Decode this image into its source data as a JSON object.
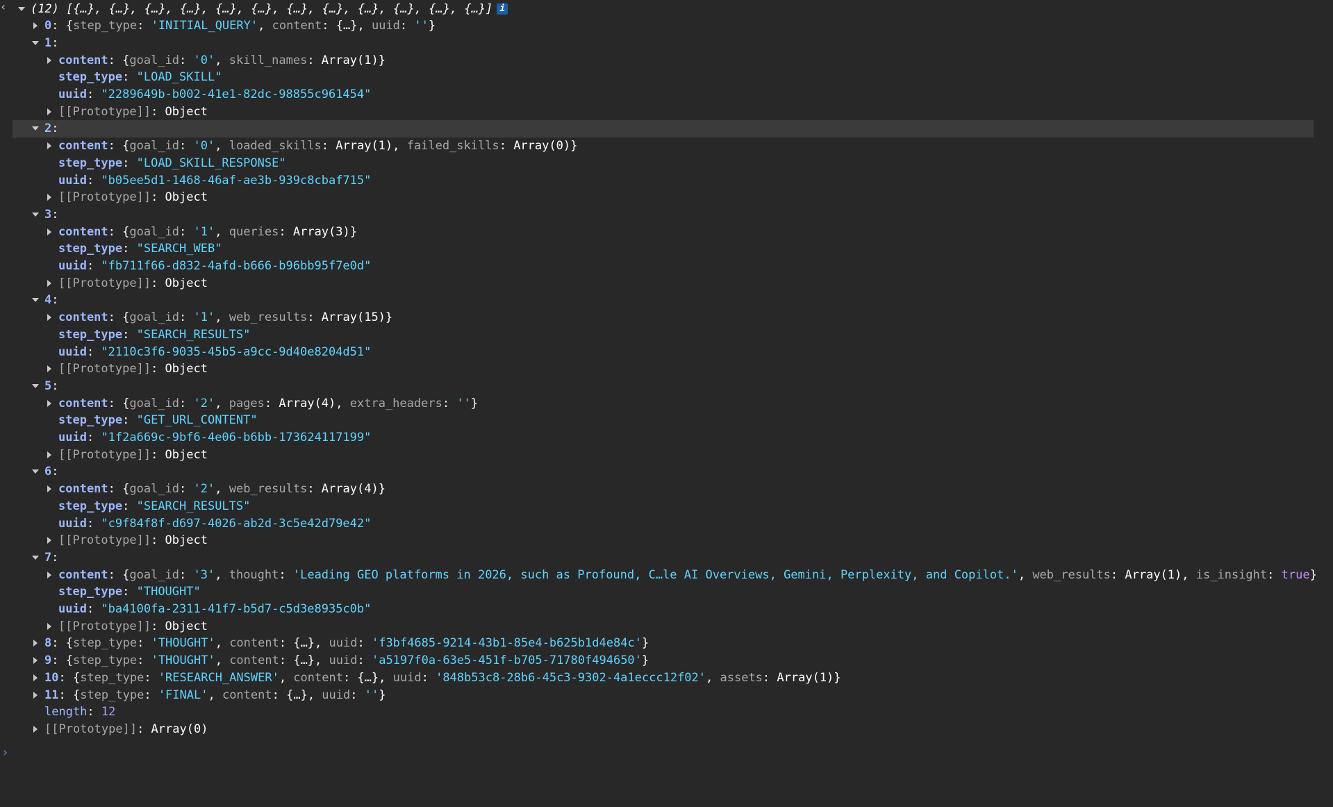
{
  "summary": {
    "count": "(12)",
    "preview": "[{…}, {…}, {…}, {…}, {…}, {…}, {…}, {…}, {…}, {…}, {…}, {…}]",
    "info_badge": "i"
  },
  "entries": [
    {
      "index": "0",
      "collapsed_parts": [
        {
          "k": "step_type",
          "v": "'INITIAL_QUERY'",
          "t": "str"
        },
        {
          "k": "content",
          "v": "{…}",
          "t": "sym"
        },
        {
          "k": "uuid",
          "v": "''",
          "t": "str"
        }
      ]
    },
    {
      "index": "1",
      "content_preview": [
        {
          "k": "goal_id",
          "v": "'0'",
          "t": "str"
        },
        {
          "k": "skill_names",
          "v": "Array(1)",
          "t": "sym"
        }
      ],
      "step_type": "\"LOAD_SKILL\"",
      "uuid": "\"2289649b-b002-41e1-82dc-98855c961454\""
    },
    {
      "index": "2",
      "content_preview": [
        {
          "k": "goal_id",
          "v": "'0'",
          "t": "str"
        },
        {
          "k": "loaded_skills",
          "v": "Array(1)",
          "t": "sym"
        },
        {
          "k": "failed_skills",
          "v": "Array(0)",
          "t": "sym"
        }
      ],
      "step_type": "\"LOAD_SKILL_RESPONSE\"",
      "uuid": "\"b05ee5d1-1468-46af-ae3b-939c8cbaf715\""
    },
    {
      "index": "3",
      "content_preview": [
        {
          "k": "goal_id",
          "v": "'1'",
          "t": "str"
        },
        {
          "k": "queries",
          "v": "Array(3)",
          "t": "sym"
        }
      ],
      "step_type": "\"SEARCH_WEB\"",
      "uuid": "\"fb711f66-d832-4afd-b666-b96bb95f7e0d\""
    },
    {
      "index": "4",
      "content_preview": [
        {
          "k": "goal_id",
          "v": "'1'",
          "t": "str"
        },
        {
          "k": "web_results",
          "v": "Array(15)",
          "t": "sym"
        }
      ],
      "step_type": "\"SEARCH_RESULTS\"",
      "uuid": "\"2110c3f6-9035-45b5-a9cc-9d40e8204d51\""
    },
    {
      "index": "5",
      "content_preview": [
        {
          "k": "goal_id",
          "v": "'2'",
          "t": "str"
        },
        {
          "k": "pages",
          "v": "Array(4)",
          "t": "sym"
        },
        {
          "k": "extra_headers",
          "v": "''",
          "t": "str"
        }
      ],
      "step_type": "\"GET_URL_CONTENT\"",
      "uuid": "\"1f2a669c-9bf6-4e06-b6bb-173624117199\""
    },
    {
      "index": "6",
      "content_preview": [
        {
          "k": "goal_id",
          "v": "'2'",
          "t": "str"
        },
        {
          "k": "web_results",
          "v": "Array(4)",
          "t": "sym"
        }
      ],
      "step_type": "\"SEARCH_RESULTS\"",
      "uuid": "\"c9f84f8f-d697-4026-ab2d-3c5e42d79e42\""
    },
    {
      "index": "7",
      "content_preview": [
        {
          "k": "goal_id",
          "v": "'3'",
          "t": "str"
        },
        {
          "k": "thought",
          "v": "'Leading GEO platforms in 2026, such as Profound, C…le AI Overviews, Gemini, Perplexity, and Copilot.'",
          "t": "str"
        },
        {
          "k": "web_results",
          "v": "Array(1)",
          "t": "sym"
        },
        {
          "k": "is_insight",
          "v": "true",
          "t": "kw"
        }
      ],
      "step_type": "\"THOUGHT\"",
      "uuid": "\"ba4100fa-2311-41f7-b5d7-c5d3e8935c0b\""
    },
    {
      "index": "8",
      "collapsed_parts": [
        {
          "k": "step_type",
          "v": "'THOUGHT'",
          "t": "str"
        },
        {
          "k": "content",
          "v": "{…}",
          "t": "sym"
        },
        {
          "k": "uuid",
          "v": "'f3bf4685-9214-43b1-85e4-b625b1d4e84c'",
          "t": "str"
        }
      ]
    },
    {
      "index": "9",
      "collapsed_parts": [
        {
          "k": "step_type",
          "v": "'THOUGHT'",
          "t": "str"
        },
        {
          "k": "content",
          "v": "{…}",
          "t": "sym"
        },
        {
          "k": "uuid",
          "v": "'a5197f0a-63e5-451f-b705-71780f494650'",
          "t": "str"
        }
      ]
    },
    {
      "index": "10",
      "collapsed_parts": [
        {
          "k": "step_type",
          "v": "'RESEARCH_ANSWER'",
          "t": "str"
        },
        {
          "k": "content",
          "v": "{…}",
          "t": "sym"
        },
        {
          "k": "uuid",
          "v": "'848b53c8-28b6-45c3-9302-4a1eccc12f02'",
          "t": "str"
        },
        {
          "k": "assets",
          "v": "Array(1)",
          "t": "sym"
        }
      ]
    },
    {
      "index": "11",
      "collapsed_parts": [
        {
          "k": "step_type",
          "v": "'FINAL'",
          "t": "str"
        },
        {
          "k": "content",
          "v": "{…}",
          "t": "sym"
        },
        {
          "k": "uuid",
          "v": "''",
          "t": "str"
        }
      ]
    }
  ],
  "labels": {
    "content": "content",
    "step_type": "step_type",
    "uuid": "uuid",
    "prototype": "[[Prototype]]",
    "object": "Object",
    "length_key": "length",
    "length_value": "12",
    "array_proto": "Array(0)"
  },
  "highlighted_index": "2",
  "prompt_symbol": "›"
}
